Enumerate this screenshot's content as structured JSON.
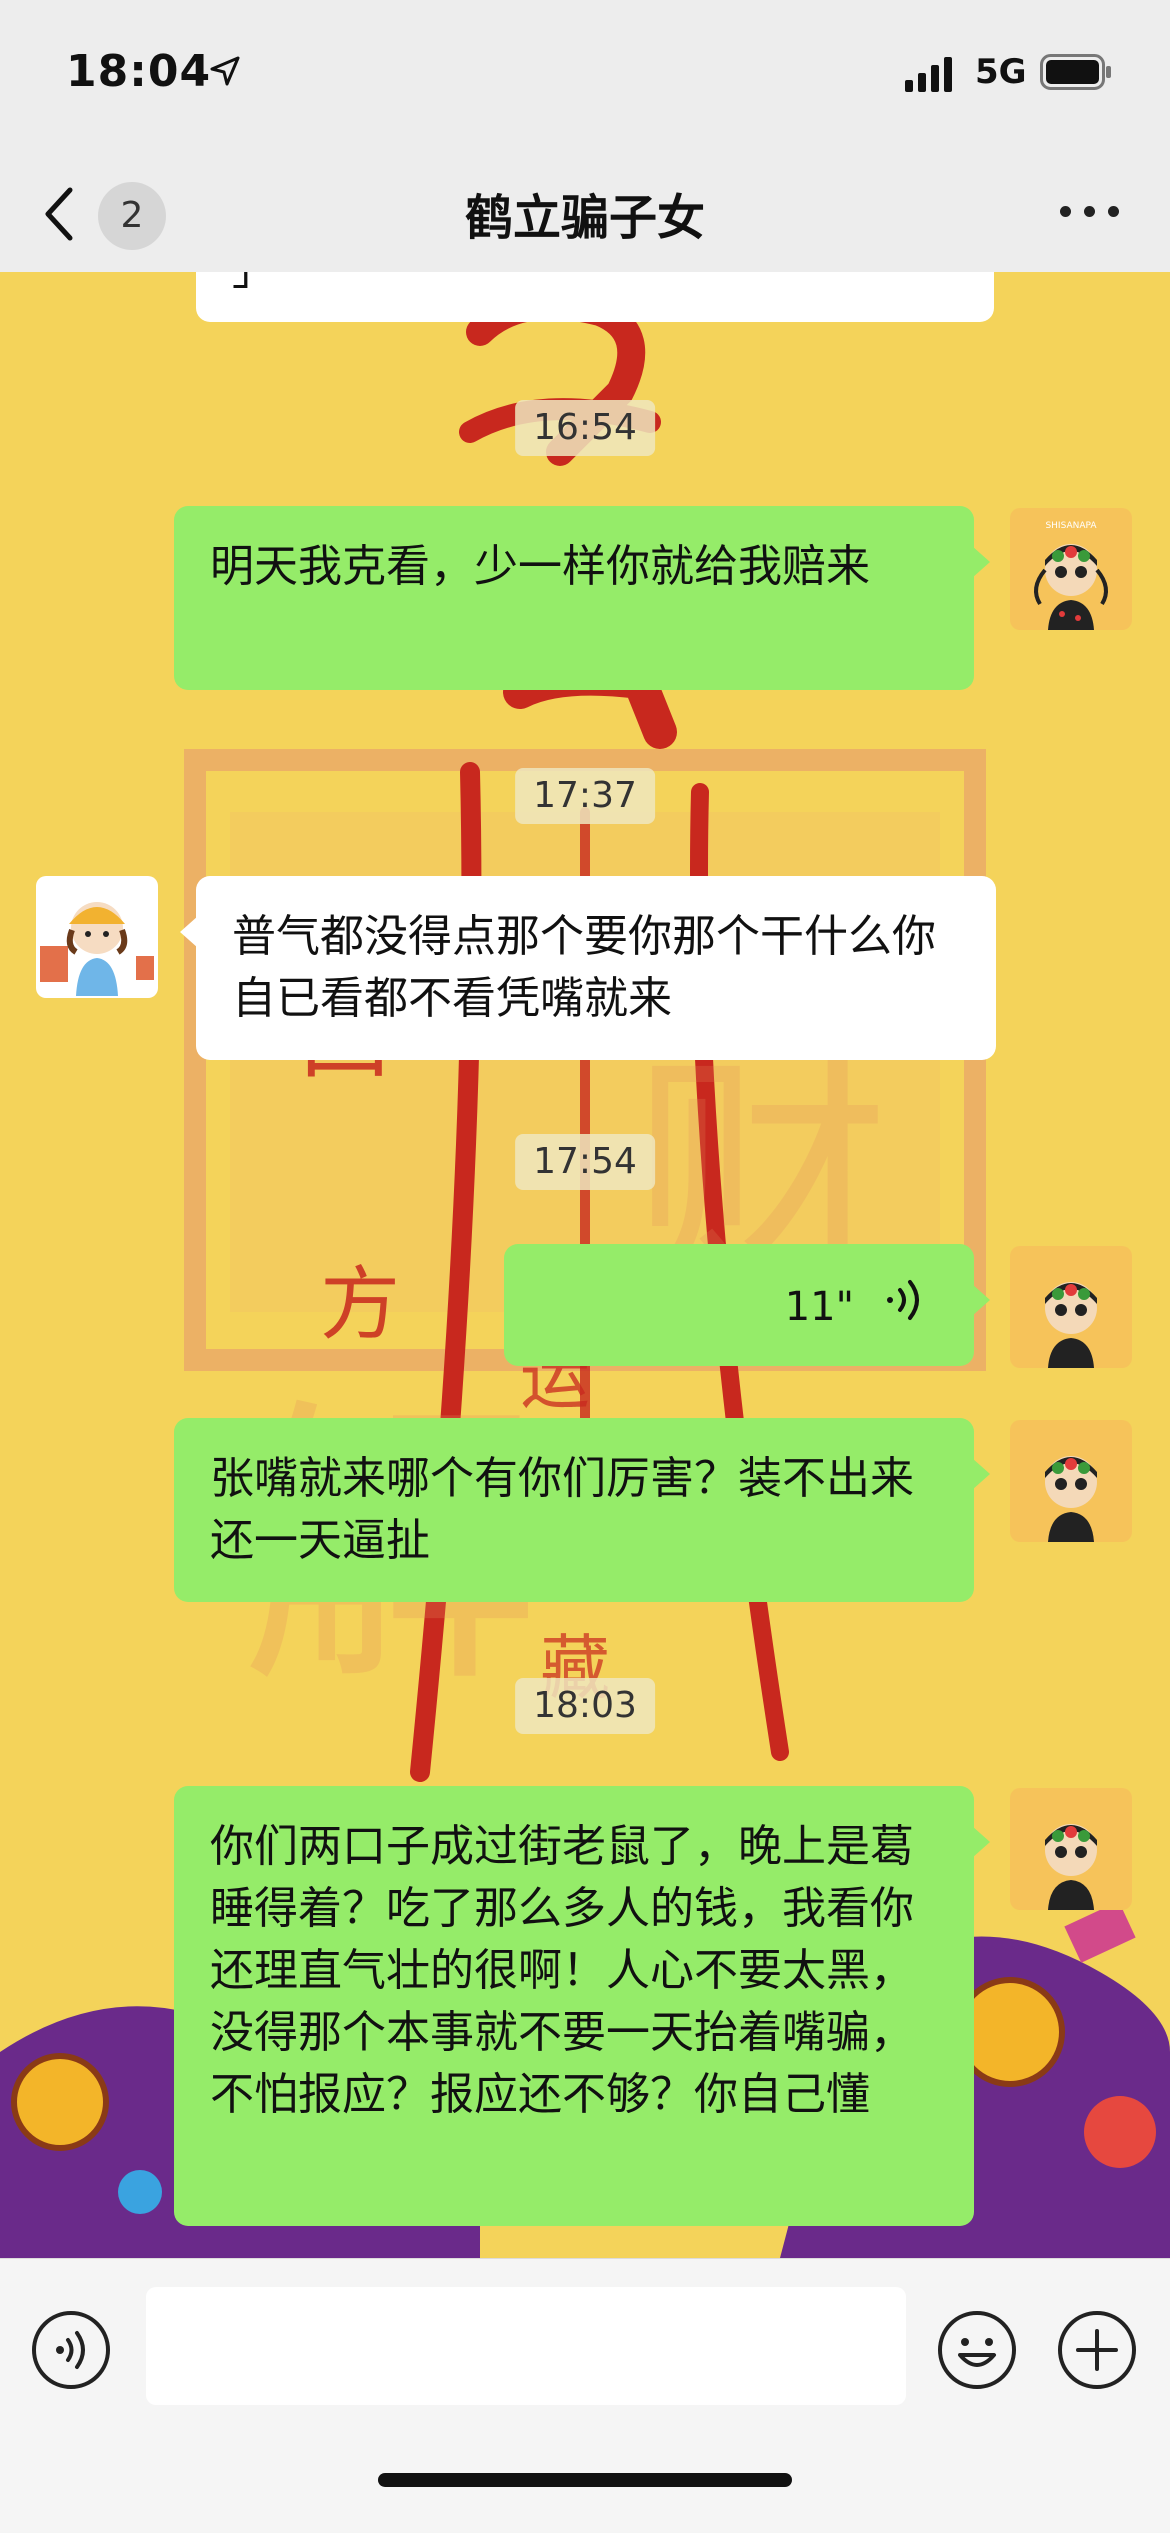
{
  "status_bar": {
    "time": "18:04",
    "network": "5G",
    "location_icon": "location-arrow-icon",
    "signal_icon": "cellular-signal-icon",
    "battery_icon": "battery-icon"
  },
  "header": {
    "unread_count": "2",
    "title": "鹤立骗子女",
    "back_icon": "chevron-left-icon",
    "more_icon": "more-dots-icon"
  },
  "messages": {
    "partial_top": "」",
    "ts1": "16:54",
    "m1": "明天我克看，少一样你就给我赔来",
    "ts2": "17:37",
    "m2": "普气都没得点那个要你那个干什么你自已看都不看凭嘴就来",
    "ts3": "17:54",
    "voice_duration": "11\"",
    "m4": "张嘴就来哪个有你们厉害？装不出来还一天逼扯",
    "ts4": "18:03",
    "m5": "你们两口子成过街老鼠了，晚上是葛睡得着？吃了那么多人的钱，我看你还理直气壮的很啊！人心不要太黑，没得那个本事就不要一天抬着嘴骗，不怕报应？报应还不够？你自己懂"
  },
  "avatars": {
    "me_label": "SHISANAPA"
  },
  "input_bar": {
    "placeholder": "",
    "voice_icon": "voice-mode-icon",
    "emoji_icon": "emoji-icon",
    "plus_icon": "plus-icon"
  },
  "colors": {
    "my_bubble": "#95ec69",
    "other_bubble": "#ffffff",
    "header_bg": "#ededed",
    "chat_bg": "#f4d35a",
    "talisman_red": "#c8281e"
  }
}
